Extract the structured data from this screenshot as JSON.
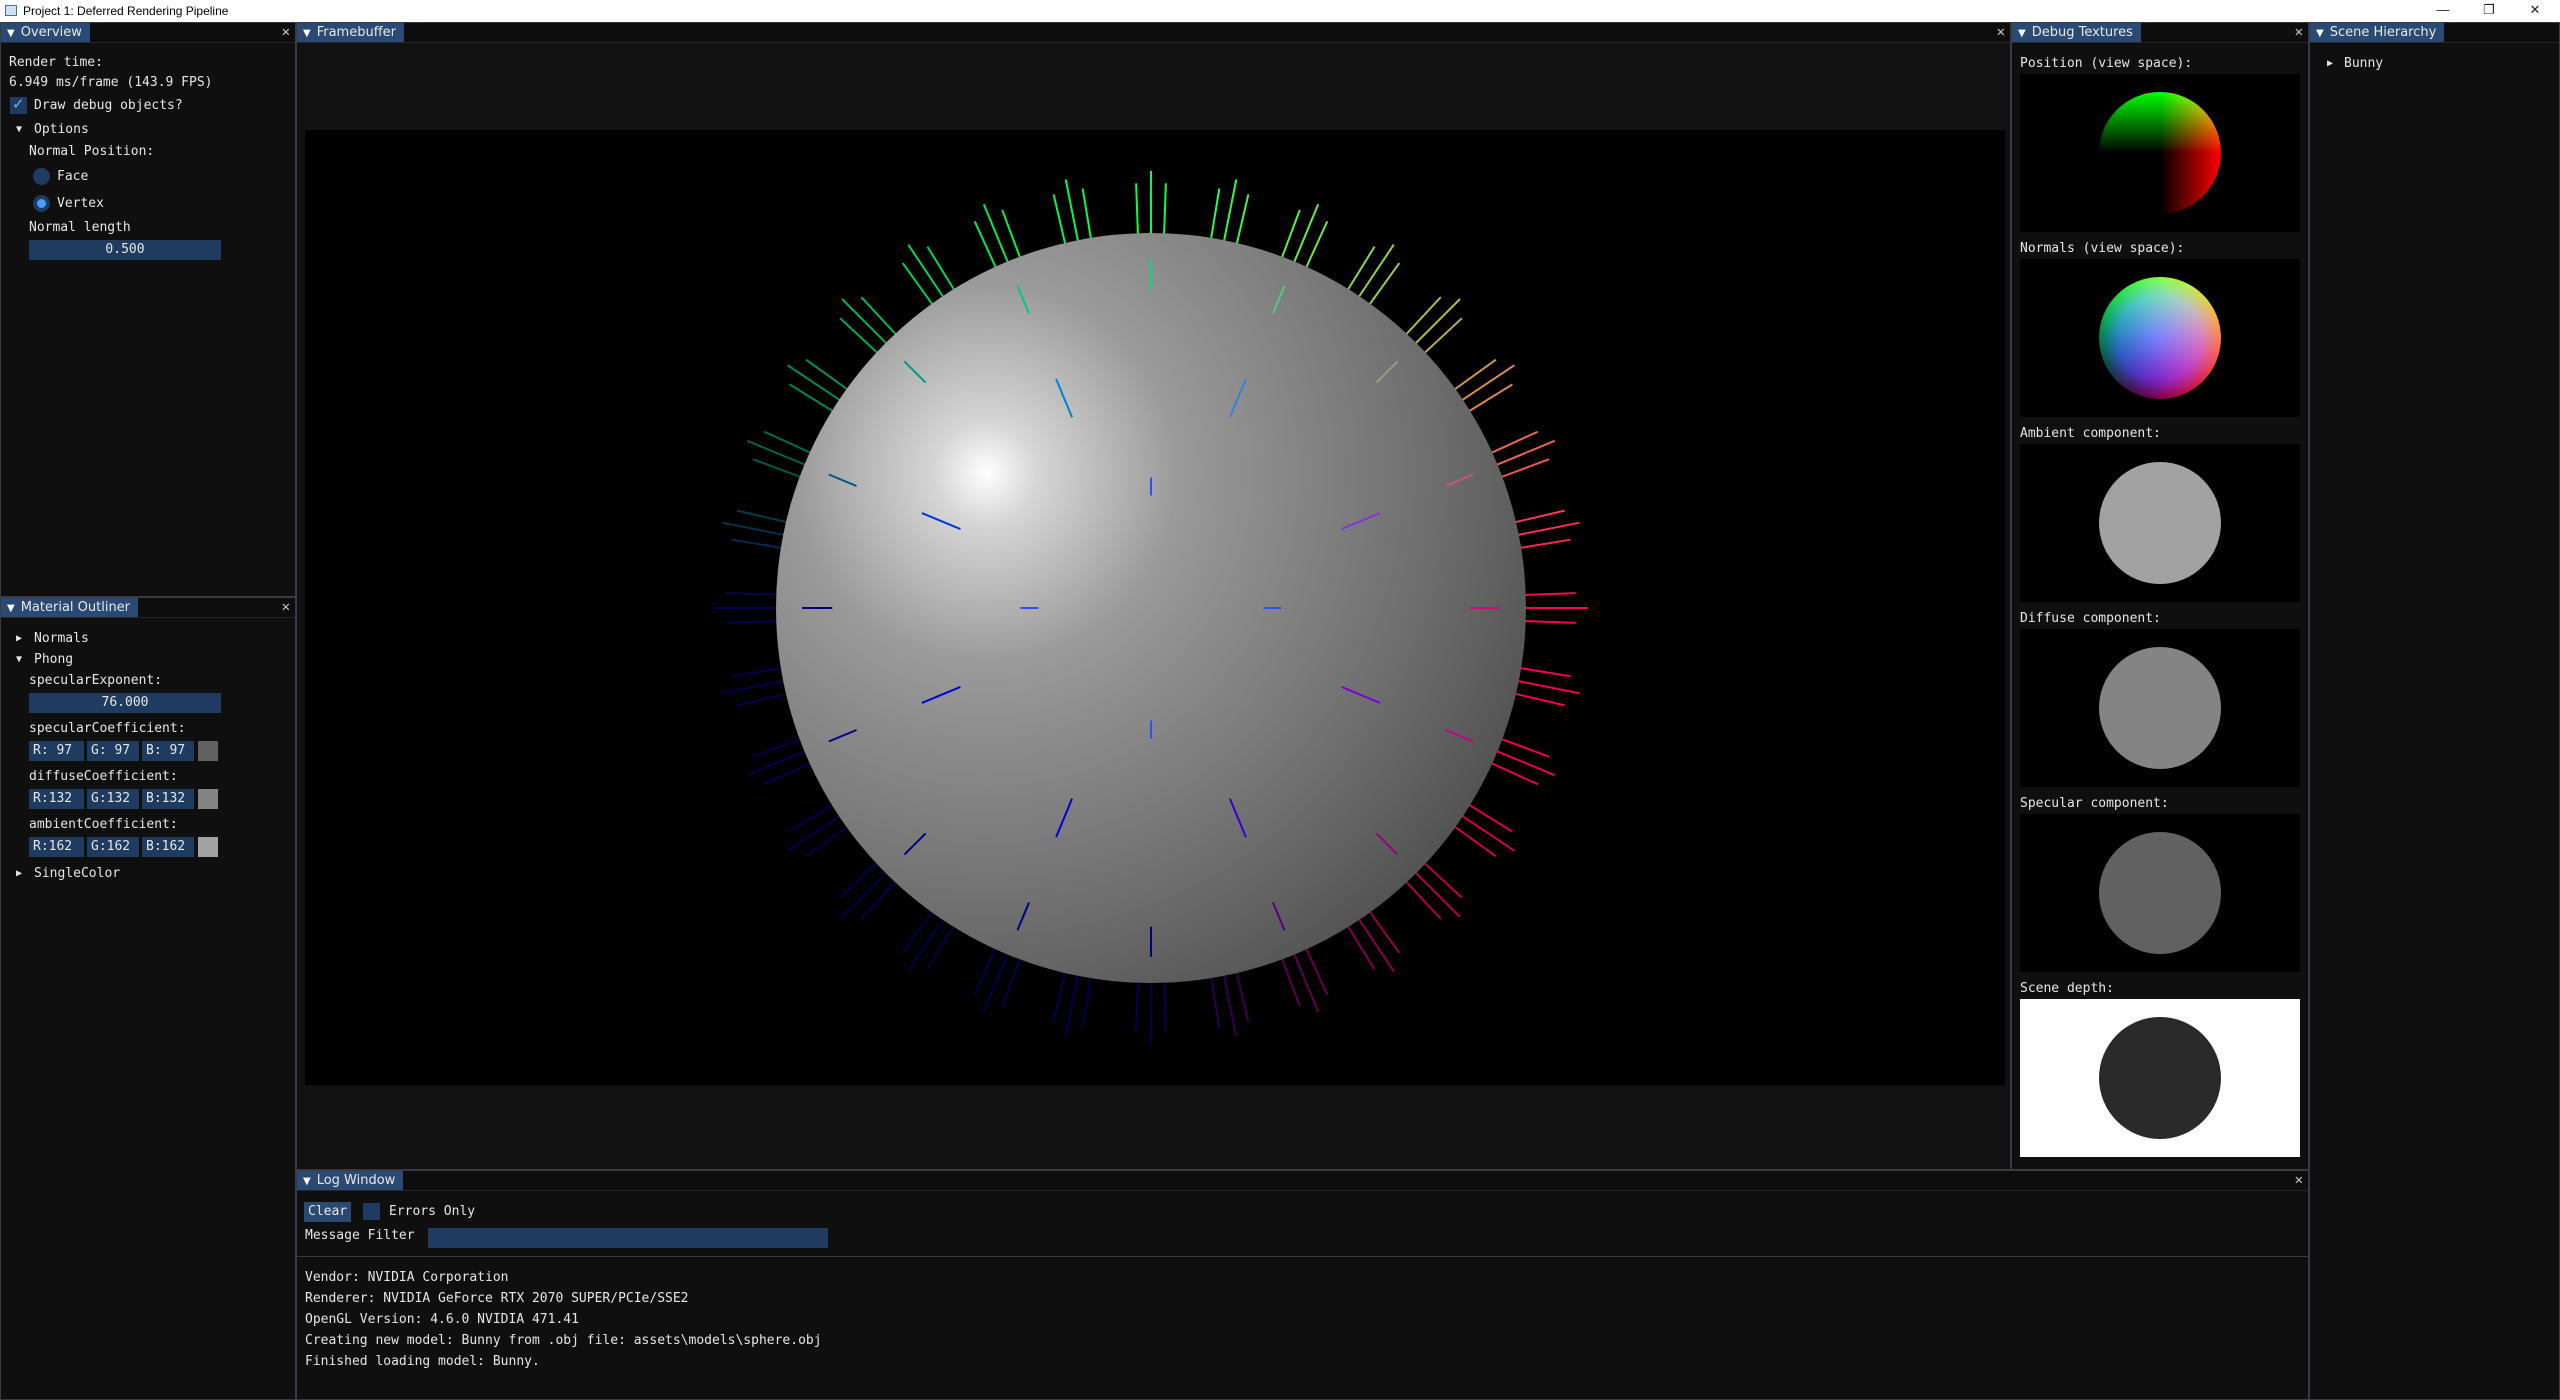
{
  "window": {
    "title": "Project 1: Deferred Rendering Pipeline",
    "minimize": "—",
    "maximize": "❐",
    "close": "✕"
  },
  "overview": {
    "tab": "Overview",
    "render_time_label": "Render time:",
    "render_time_value": "6.949 ms/frame (143.9 FPS)",
    "draw_debug_label": "Draw debug objects?",
    "draw_debug_checked": true,
    "options_label": "Options",
    "normal_position_label": "Normal Position:",
    "radio_face": "Face",
    "radio_vertex": "Vertex",
    "selected_normal_position": "Vertex",
    "normal_length_label": "Normal length",
    "normal_length_value": "0.500"
  },
  "framebuffer": {
    "tab": "Framebuffer"
  },
  "debug_textures": {
    "tab": "Debug Textures",
    "labels": {
      "position": "Position (view space):",
      "normals": "Normals (view space):",
      "ambient": "Ambient component:",
      "diffuse": "Diffuse component:",
      "specular": "Specular component:",
      "depth": "Scene depth:"
    },
    "colors": {
      "ambient": "#a2a2a2",
      "diffuse": "#848484",
      "specular": "#616161",
      "depth_bg": "#ffffff",
      "depth_sphere": "#2a2a2a"
    }
  },
  "scene_hierarchy": {
    "tab": "Scene Hierarchy",
    "items": [
      "Bunny"
    ]
  },
  "material_outliner": {
    "tab": "Material Outliner",
    "normals_label": "Normals",
    "phong_label": "Phong",
    "specular_exponent_label": "specularExponent:",
    "specular_exponent_value": "76.000",
    "specular_coefficient_label": "specularCoefficient:",
    "specular": {
      "r": "R: 97",
      "g": "G: 97",
      "b": "B: 97",
      "swatch": "#616161"
    },
    "diffuse_coefficient_label": "diffuseCoefficient:",
    "diffuse": {
      "r": "R:132",
      "g": "G:132",
      "b": "B:132",
      "swatch": "#848484"
    },
    "ambient_coefficient_label": "ambientCoefficient:",
    "ambient": {
      "r": "R:162",
      "g": "G:162",
      "b": "B:162",
      "swatch": "#a2a2a2"
    },
    "single_color_label": "SingleColor"
  },
  "log_window": {
    "tab": "Log Window",
    "clear_label": "Clear",
    "errors_only_label": "Errors Only",
    "message_filter_label": "Message Filter",
    "message_filter_value": "",
    "lines": [
      "Vendor: NVIDIA Corporation",
      "Renderer: NVIDIA GeForce RTX 2070 SUPER/PCIe/SSE2",
      "OpenGL Version: 4.6.0 NVIDIA 471.41",
      "Creating new model: Bunny from .obj file: assets\\models\\sphere.obj",
      "Finished loading model: Bunny."
    ]
  },
  "theme": {
    "accent": "#2b4a73",
    "field": "#1f3b60",
    "check": "#66b3ff"
  }
}
